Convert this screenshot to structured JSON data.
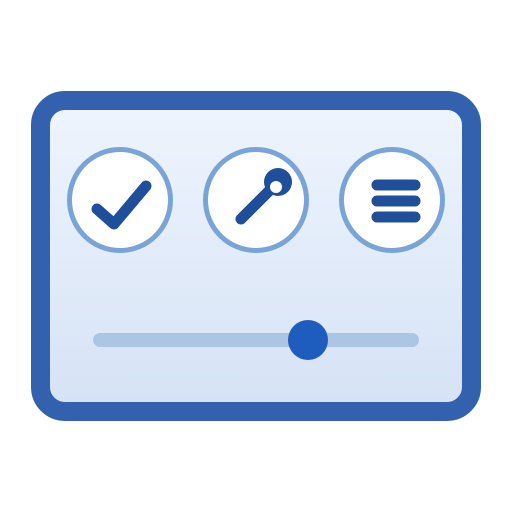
{
  "widget": {
    "buttons": [
      {
        "icon": "check-icon"
      },
      {
        "icon": "wrench-icon"
      },
      {
        "icon": "menu-icon"
      }
    ],
    "slider": {
      "value_fraction": 0.66
    }
  },
  "colors": {
    "frame": "#3461ad",
    "panel_top": "#eef4fd",
    "panel_bottom": "#d6e3f6",
    "button_ring": "#78a4d8",
    "icon_dark": "#1f4f9a",
    "slider_track": "#adc5e4",
    "slider_thumb": "#1e5dbe"
  }
}
